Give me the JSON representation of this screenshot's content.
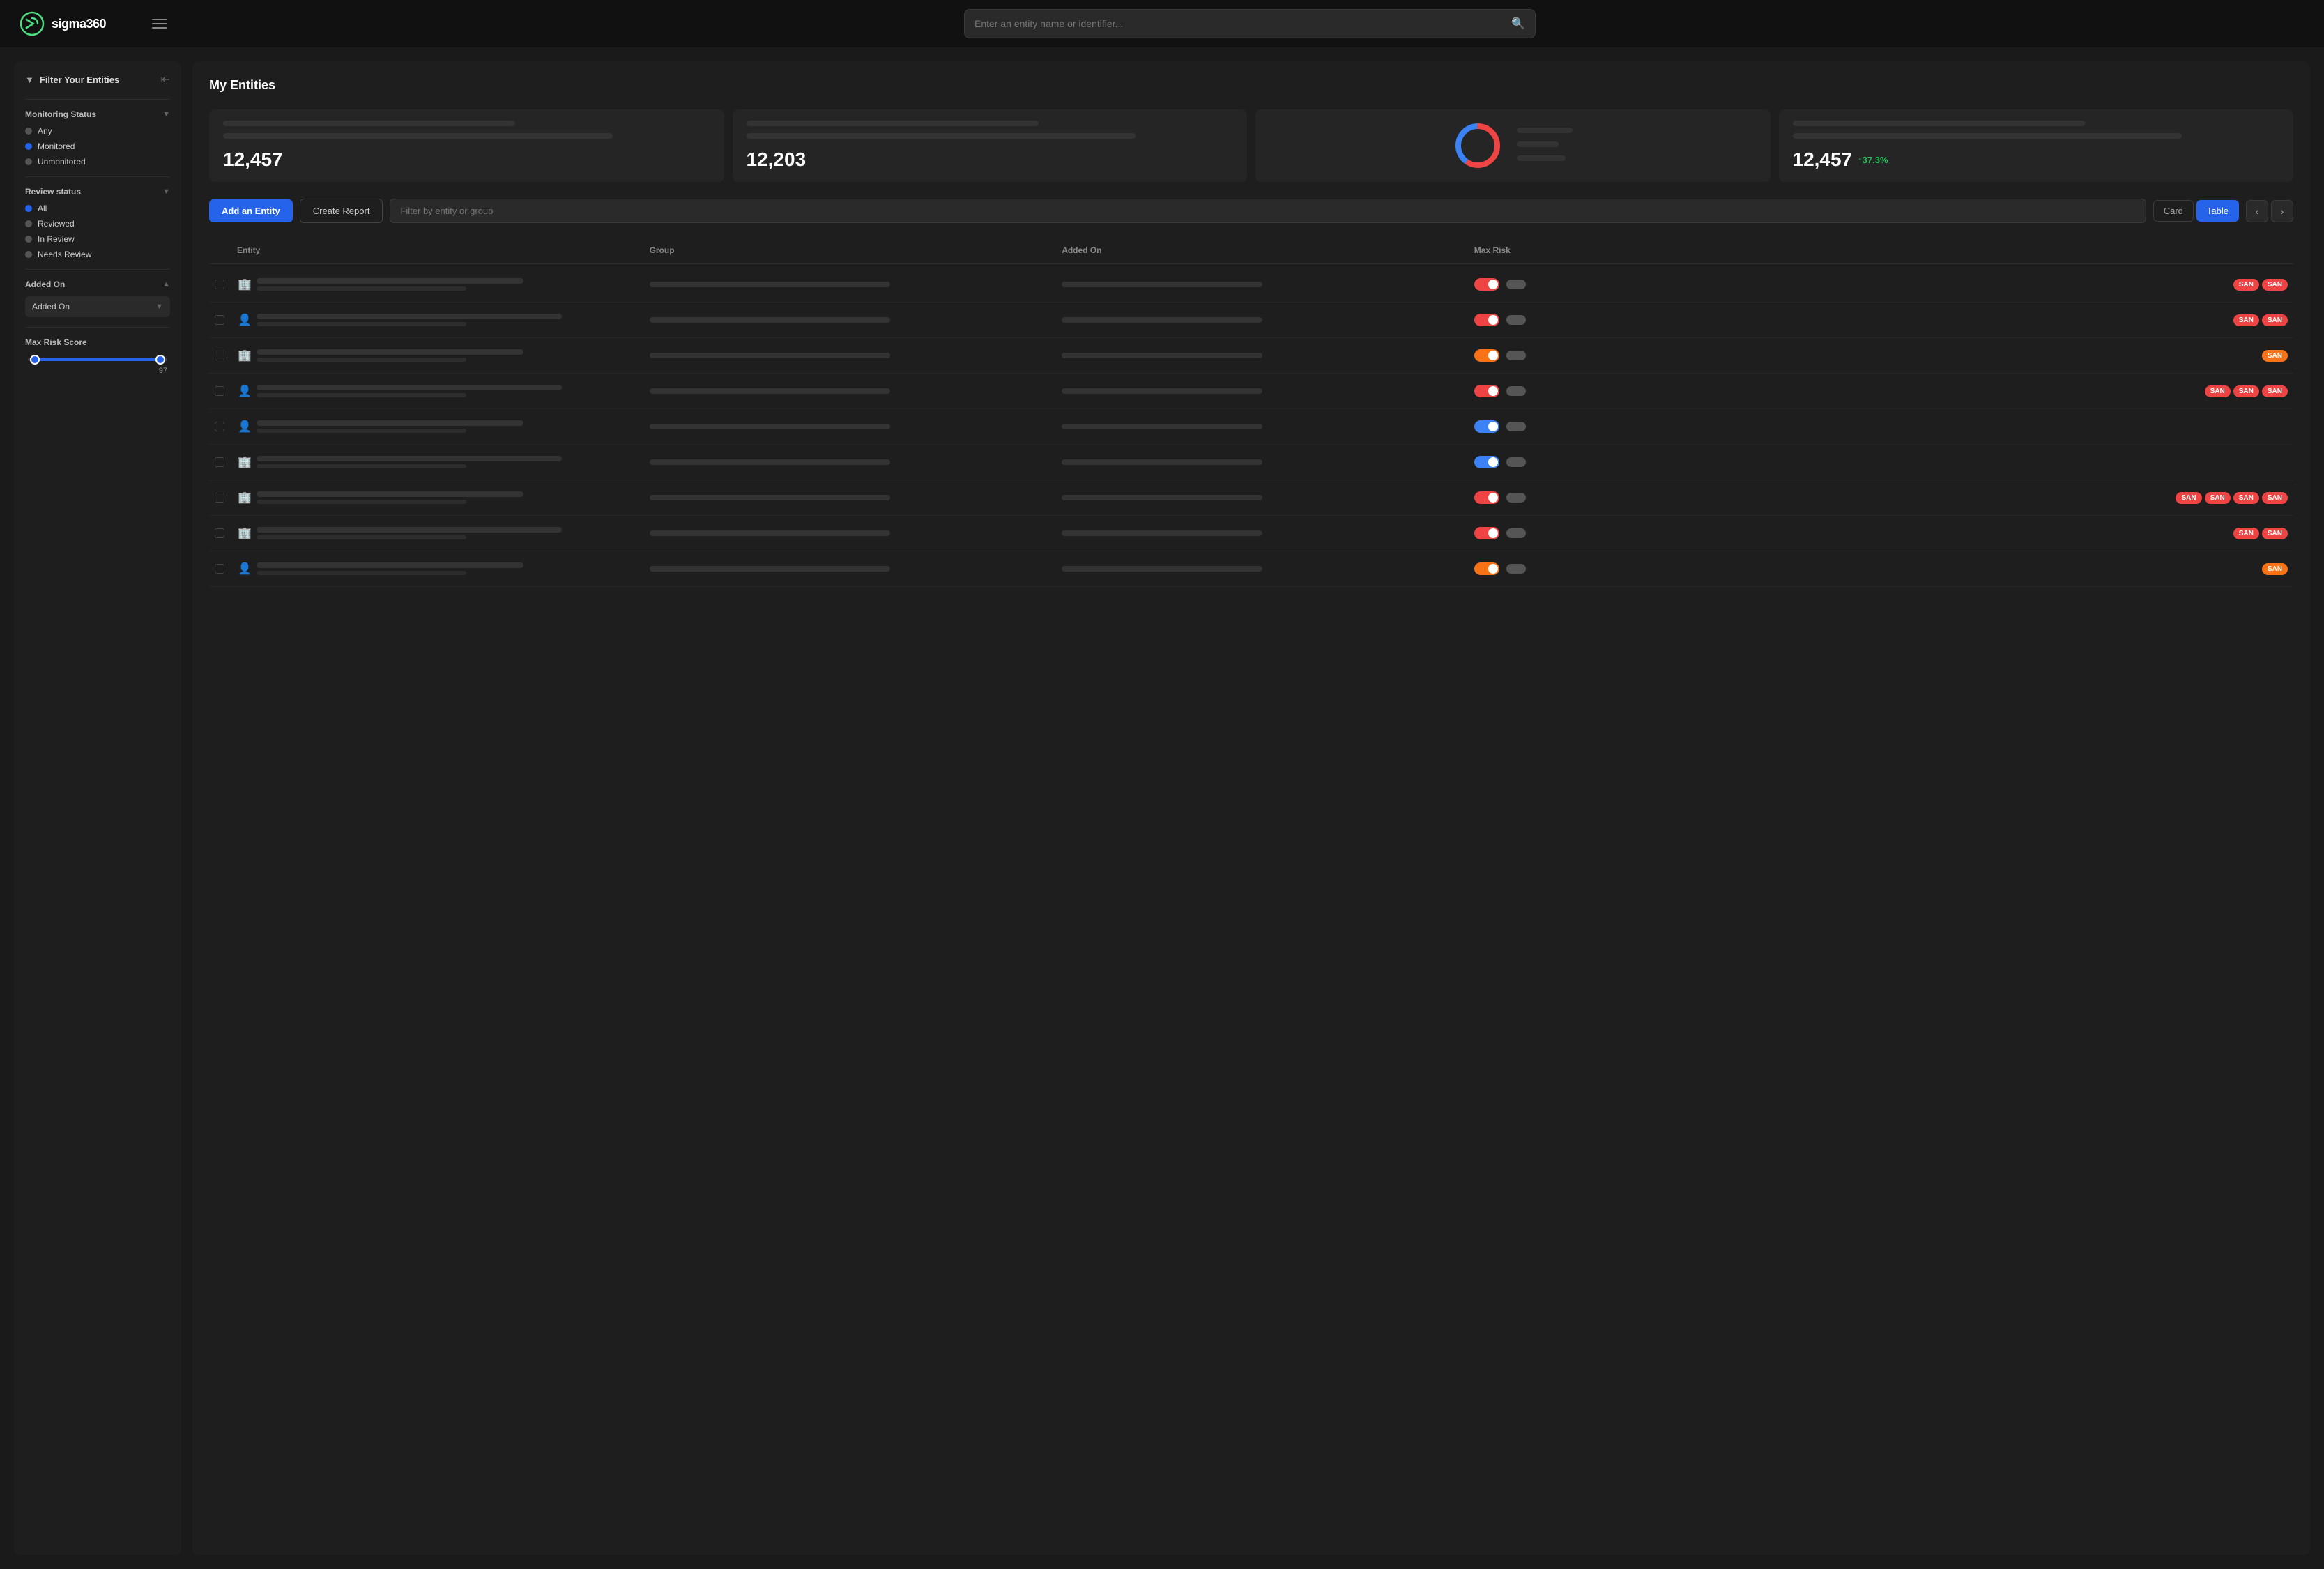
{
  "app": {
    "name": "sigma360",
    "logo_unicode": "⟳"
  },
  "nav": {
    "search_placeholder": "Enter an entity name or identifier..."
  },
  "sidebar": {
    "title": "Filter Your Entities",
    "sections": [
      {
        "id": "monitoring_status",
        "title": "Monitoring Status",
        "options": [
          {
            "label": "Any",
            "state": "gray"
          },
          {
            "label": "Monitored",
            "state": "active"
          },
          {
            "label": "Unmonitored",
            "state": "gray"
          }
        ]
      },
      {
        "id": "review_status",
        "title": "Review status",
        "options": [
          {
            "label": "All",
            "state": "active"
          },
          {
            "label": "Reviewed",
            "state": "gray"
          },
          {
            "label": "In Review",
            "state": "gray"
          },
          {
            "label": "Needs Review",
            "state": "gray"
          }
        ]
      }
    ],
    "added_on": {
      "title": "Added On",
      "dropdown_label": "Added On"
    },
    "max_risk": {
      "title": "Max Risk Score",
      "value": "97",
      "min": 0,
      "max": 100
    }
  },
  "content": {
    "page_title": "My Entities",
    "stats": [
      {
        "number": "12,457",
        "show_number": true
      },
      {
        "number": "12,203",
        "show_number": true
      },
      {
        "chart": "donut",
        "show_chart": true
      },
      {
        "number": "12,457",
        "badge": "↑37.3%",
        "show_number": true
      }
    ],
    "toolbar": {
      "add_entity_label": "Add an Entity",
      "create_report_label": "Create Report",
      "filter_placeholder": "Filter by entity or group",
      "view_card_label": "Card",
      "view_table_label": "Table"
    },
    "table": {
      "columns": [
        "",
        "Entity",
        "Group",
        "Added On",
        "Max Risk",
        ""
      ],
      "rows": [
        {
          "icon": "building",
          "toggle_color": "red",
          "san_badges": [
            "SAN",
            "SAN"
          ]
        },
        {
          "icon": "person",
          "toggle_color": "red",
          "san_badges": [
            "SAN",
            "SAN"
          ]
        },
        {
          "icon": "building",
          "toggle_color": "orange",
          "san_badges": [
            "SAN"
          ]
        },
        {
          "icon": "person",
          "toggle_color": "red",
          "san_badges": [
            "SAN",
            "SAN",
            "SAN"
          ]
        },
        {
          "icon": "person",
          "toggle_color": "blue",
          "san_badges": []
        },
        {
          "icon": "building",
          "toggle_color": "blue",
          "san_badges": []
        },
        {
          "icon": "building",
          "toggle_color": "red",
          "san_badges": [
            "SAN",
            "SAN",
            "SAN",
            "SAN"
          ]
        },
        {
          "icon": "building",
          "toggle_color": "red",
          "san_badges": [
            "SAN",
            "SAN"
          ]
        },
        {
          "icon": "person",
          "toggle_color": "orange",
          "san_badges": [
            "SAN"
          ]
        }
      ]
    }
  }
}
